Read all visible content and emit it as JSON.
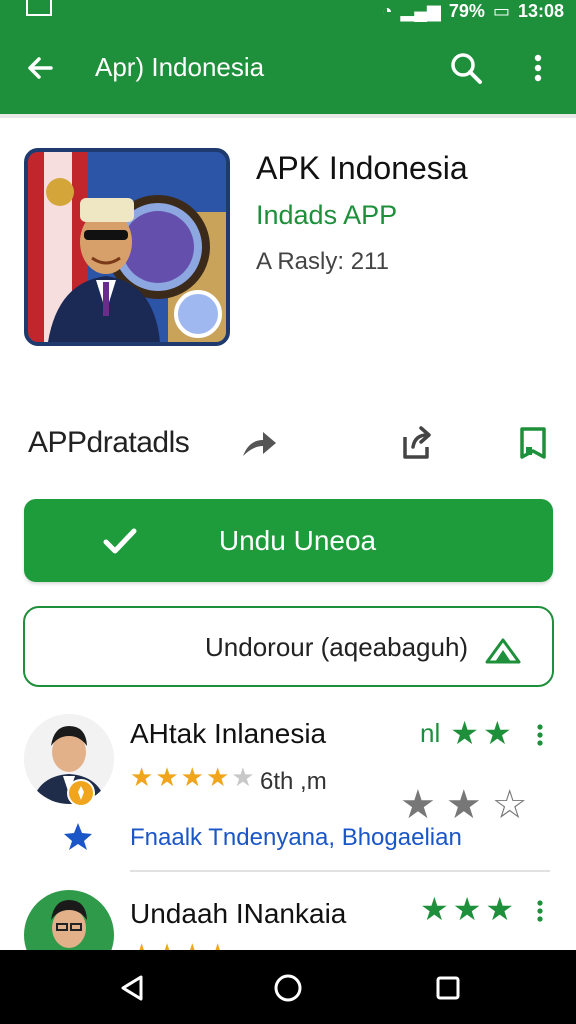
{
  "status_bar": {
    "battery": "79%",
    "time": "13:08"
  },
  "app_bar": {
    "title": "Apr) Indonesia"
  },
  "app": {
    "name": "APK Indonesia",
    "developer": "Indads APP",
    "rating_text": "A Rasly: 211"
  },
  "actions": {
    "details_label": "APPdratadls"
  },
  "buttons": {
    "primary_label": "Undu Uneoa",
    "secondary_label": "Undorour (aqeabaguh)"
  },
  "reviews": [
    {
      "name": "AHtak Inlanesia",
      "label": "nl",
      "meta": "6th ,m",
      "tags": "Fnaalk  Tndenyana,   Bhogaelian"
    },
    {
      "name": "Undaah INankaia",
      "label": "",
      "meta": "",
      "tags": ""
    }
  ],
  "colors": {
    "brand": "#1e8f3a",
    "primary_button": "#1e9c3c",
    "link": "#1a56c8",
    "star_gold": "#f0a51c"
  },
  "icons": [
    "back-arrow-icon",
    "search-icon",
    "more-vert-icon",
    "share-icon",
    "export-icon",
    "bookmark-icon",
    "check-icon",
    "nav-back-icon",
    "nav-home-icon",
    "nav-recent-icon"
  ]
}
